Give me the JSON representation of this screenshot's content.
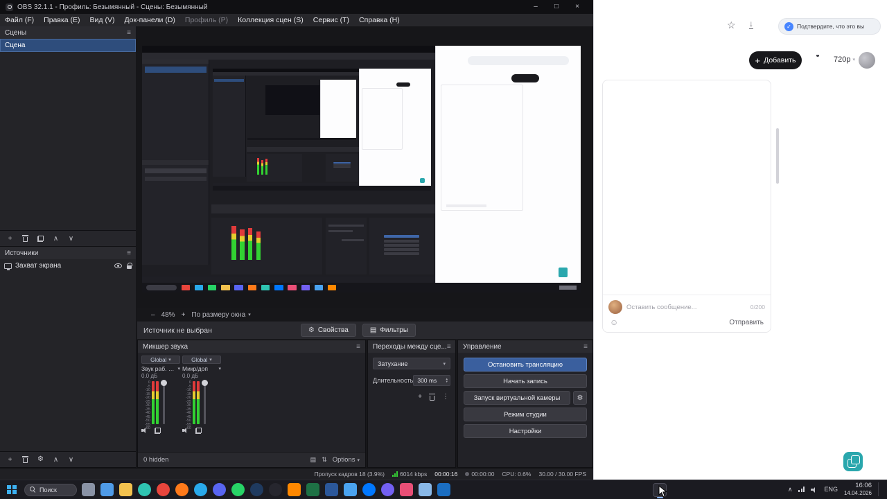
{
  "theme": {
    "accent_blue": "#3a5f9e",
    "scene_selected": "#2e4d7c",
    "panel_dark": "#222227",
    "meter_green": "#32d232",
    "meter_yellow": "#e5cd2e",
    "meter_red": "#e03b3b",
    "site_teal": "#2aa7ad",
    "add_button_black": "#18181b"
  },
  "glyphs": {
    "star": "☆",
    "download": "↓",
    "check": "✓",
    "gear": "⚙",
    "caret": "▾",
    "caret_up": "▴",
    "menu": "≡",
    "kebab": "⋮",
    "up": "∧",
    "down": "∨",
    "plus": "+",
    "grid": "▤",
    "sort": "⇅",
    "smiley": "☺",
    "tray_up": "∧"
  },
  "obs": {
    "title": "OBS 32.1.1 - Профиль: Безымянный - Сцены: Безымянный",
    "window_buttons": {
      "minimize": "–",
      "maximize": "□",
      "close": "×"
    },
    "menu": [
      "Файл (F)",
      "Правка (E)",
      "Вид (V)",
      "Док-панели (D)",
      "Профиль (P)",
      "Коллекция сцен (S)",
      "Сервис (T)",
      "Справка (H)"
    ],
    "scenes_panel": {
      "title": "Сцены",
      "scene": "Сцена"
    },
    "sources_panel": {
      "title": "Источники",
      "source": "Захват экрана"
    },
    "preview_toolbar": {
      "zoom_out": "–",
      "zoom_level": "48%",
      "zoom_in": "+",
      "fit_mode": "По размеру окна"
    },
    "source_bar": {
      "status": "Источник не выбран",
      "properties": "Свойства",
      "filters": "Фильтры"
    },
    "mixer": {
      "title": "Микшер звука",
      "bus_label": "Global",
      "channels": [
        {
          "name": "Звук раб. стола",
          "db": "0.0 дБ"
        },
        {
          "name": "Микр/доп",
          "db": "0.0 дБ"
        }
      ],
      "scale": [
        "0",
        "-5",
        "-10",
        "-15",
        "-20",
        "-25",
        "-30",
        "-35",
        "-40",
        "-45",
        "-50",
        "-55",
        "-60"
      ],
      "hidden_count": "0 hidden",
      "options": "Options"
    },
    "transitions": {
      "title": "Переходы между сце...",
      "current": "Затухание",
      "duration_label": "Длительность",
      "duration": "300 ms"
    },
    "controls": {
      "title": "Управление",
      "stop_stream": "Остановить трансляцию",
      "start_record": "Начать запись",
      "virtual_camera": "Запуск виртуальной камеры",
      "studio_mode": "Режим студии",
      "settings": "Настройки"
    },
    "status_bar": {
      "dropped_frames": "Пропуск кадров 18 (3.9%)",
      "bitrate": "6014 kbps",
      "stream_time": "00:00:16",
      "record_time": "00:00:00",
      "cpu": "CPU: 0.6%",
      "fps": "30.00 / 30.00 FPS"
    }
  },
  "site": {
    "verify_banner": "Подтвердите, что это вы",
    "add_button": "Добавить",
    "quality": "720p",
    "chat": {
      "placeholder": "Оставить сообщение...",
      "counter": "0/200",
      "send": "Отправить"
    }
  },
  "taskbar": {
    "search": "Поиск",
    "lang": "ENG",
    "time": "16:06",
    "date": "14.04.2026",
    "icons": [
      {
        "name": "task-view",
        "color": "#8a93a6"
      },
      {
        "name": "widgets",
        "color": "#4f9be8"
      },
      {
        "name": "explorer",
        "color": "#f2c14e"
      },
      {
        "name": "edge",
        "color": "#2fc4b2",
        "round": true
      },
      {
        "name": "chrome",
        "color": "#e8453c",
        "round": true
      },
      {
        "name": "firefox",
        "color": "#ff7a1a",
        "round": true
      },
      {
        "name": "telegram",
        "color": "#29a9eb",
        "round": true
      },
      {
        "name": "discord",
        "color": "#5865f2",
        "round": true
      },
      {
        "name": "whatsapp",
        "color": "#27d366",
        "round": true
      },
      {
        "name": "steam",
        "color": "#1f3a5f",
        "round": true
      },
      {
        "name": "obs-studio",
        "color": "#26262e",
        "round": true
      },
      {
        "name": "vlc",
        "color": "#ff8800"
      },
      {
        "name": "excel",
        "color": "#1e7145"
      },
      {
        "name": "word",
        "color": "#2b579a"
      },
      {
        "name": "photos",
        "color": "#4aa3f0"
      },
      {
        "name": "vk",
        "color": "#0077ff",
        "round": true
      },
      {
        "name": "viber",
        "color": "#7360f2",
        "round": true
      },
      {
        "name": "paint",
        "color": "#e94f77"
      },
      {
        "name": "notepad",
        "color": "#89b8e8"
      },
      {
        "name": "mail",
        "color": "#1b6ec2"
      }
    ]
  }
}
